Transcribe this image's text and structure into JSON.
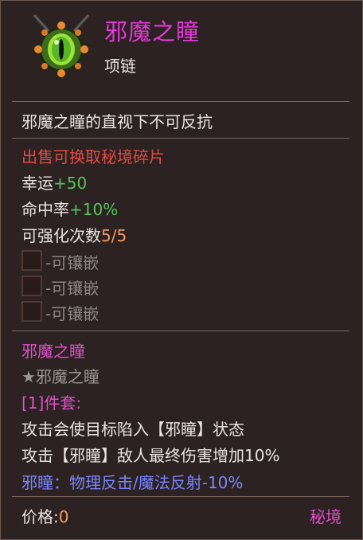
{
  "item": {
    "name": "邪魔之瞳",
    "type": "项链",
    "icon": "green-eye-necklace-icon"
  },
  "description": "邪魔之瞳的直视下不可反抗",
  "sell_note": "出售可换取秘境碎片",
  "stats": [
    {
      "label": "幸运",
      "value": "+50"
    },
    {
      "label": "命中率",
      "value": "+10%"
    }
  ],
  "enhance": {
    "label": "可强化次数",
    "value": "5/5"
  },
  "sockets": [
    "-可镶嵌",
    "-可镶嵌",
    "-可镶嵌"
  ],
  "set": {
    "name": "邪魔之瞳",
    "star_name": "★邪魔之瞳",
    "pieces": "[1]件套:",
    "effects": [
      "攻击会使目标陷入【邪瞳】状态",
      "攻击【邪瞳】敌人最终伤害增加10%"
    ],
    "special": "邪瞳：物理反击/魔法反射-10%"
  },
  "price": {
    "label": "价格:",
    "value": "0"
  },
  "source": "秘境",
  "colors": {
    "title": "#e43ad6",
    "sell": "#e24a45",
    "stat_value": "#56c45a",
    "enhance_value": "#f39a60",
    "set_name": "#e04fc9",
    "special": "#7a86ff"
  }
}
